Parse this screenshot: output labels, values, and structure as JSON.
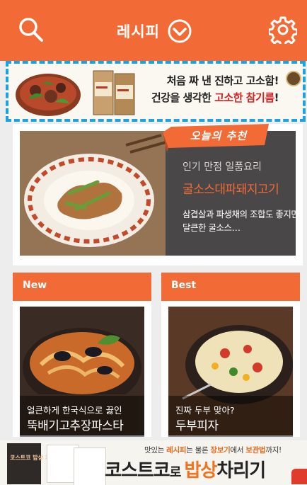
{
  "header": {
    "title": "레시피",
    "search_icon": "search-icon",
    "dropdown_icon": "chevron-down-circle-icon",
    "settings_icon": "gear-icon",
    "color": "#f26a35"
  },
  "top_ad": {
    "line1": "처음 짜 낸 진하고 고소함!",
    "line2_pre": "건강을 생각한 ",
    "line2_hl": "고소한 참기름",
    "line2_post": "!",
    "highlight_color": "#d72020"
  },
  "recommend": {
    "badge": "오늘의 추천",
    "subtitle": "인기 만점 일품요리",
    "title": "굴소스대파돼지고기",
    "description": "삼겹살과 파생채의 조합도 좋지만 달큰한 굴소스…"
  },
  "cards": [
    {
      "label": "New",
      "subtitle": "얼큰하게 한국식으로 끓인",
      "title": "뚝배기고추장파스타"
    },
    {
      "label": "Best",
      "subtitle": "진짜 두부 맞아?",
      "title": "두부피자"
    }
  ],
  "bottom_ad": {
    "book_title": "코스트코 밥상 차리기",
    "line1_a": "맛있는 ",
    "line1_b": "레시피",
    "line1_c": "는 물론 ",
    "line1_d": "장보기",
    "line1_e": "에서 ",
    "line1_f": "보관법",
    "line1_g": "까지!",
    "line2_a": "코스트코",
    "line2_b": "로 ",
    "line2_c": "밥상",
    "line2_d": "차리기"
  }
}
